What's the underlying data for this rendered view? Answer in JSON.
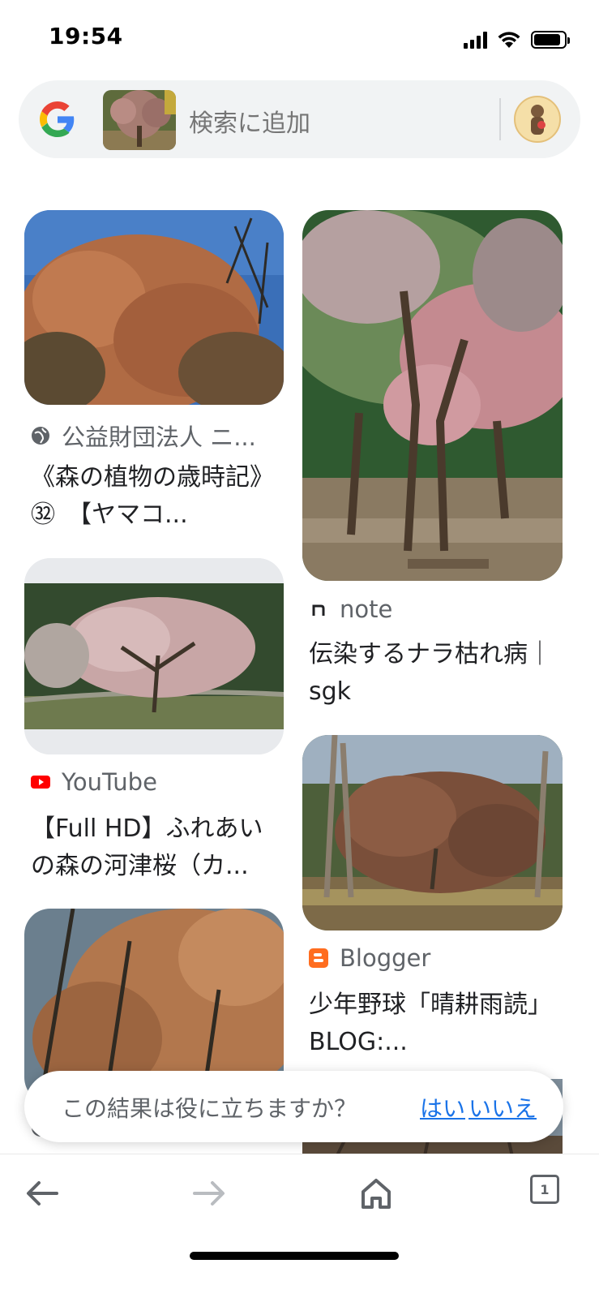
{
  "status_bar": {
    "time": "19:54",
    "battery_level": 0.9
  },
  "search": {
    "placeholder": "検索に追加",
    "google_logo_icon": "google-g-logo",
    "thumbnail": "tree-with-reddish-leaves",
    "avatar": "user-avatar"
  },
  "results": [
    {
      "source": "公益財団法人 ニ...",
      "source_icon": "globe-icon",
      "title": "《森の植物の歳時記》㉜　【ヤマコ...",
      "image": "autumn-tree-blue-sky"
    },
    {
      "source": "note",
      "source_icon": "note-logo",
      "title": "伝染するナラ枯れ病｜sgk",
      "image": "pink-leaf-trees-park"
    },
    {
      "source": "YouTube",
      "source_icon": "youtube-logo",
      "title": "【Full HD】ふれあいの森の河津桜（カ...",
      "image": "blossoming-tree-field"
    },
    {
      "source": "Blogger",
      "source_icon": "blogger-logo",
      "title": "少年野球「晴耕雨読」BLOG:...",
      "image": "brown-tree-forest"
    },
    {
      "source": "",
      "source_icon": "globe-icon",
      "title": "",
      "image": "autumn-branches"
    }
  ],
  "feedback": {
    "question": "この結果は役に立ちますか？",
    "yes": "はい",
    "no": "いいえ"
  },
  "nav": {
    "back": "back-arrow-icon",
    "forward": "forward-arrow-icon",
    "home": "home-icon",
    "tabs_count": "1"
  }
}
